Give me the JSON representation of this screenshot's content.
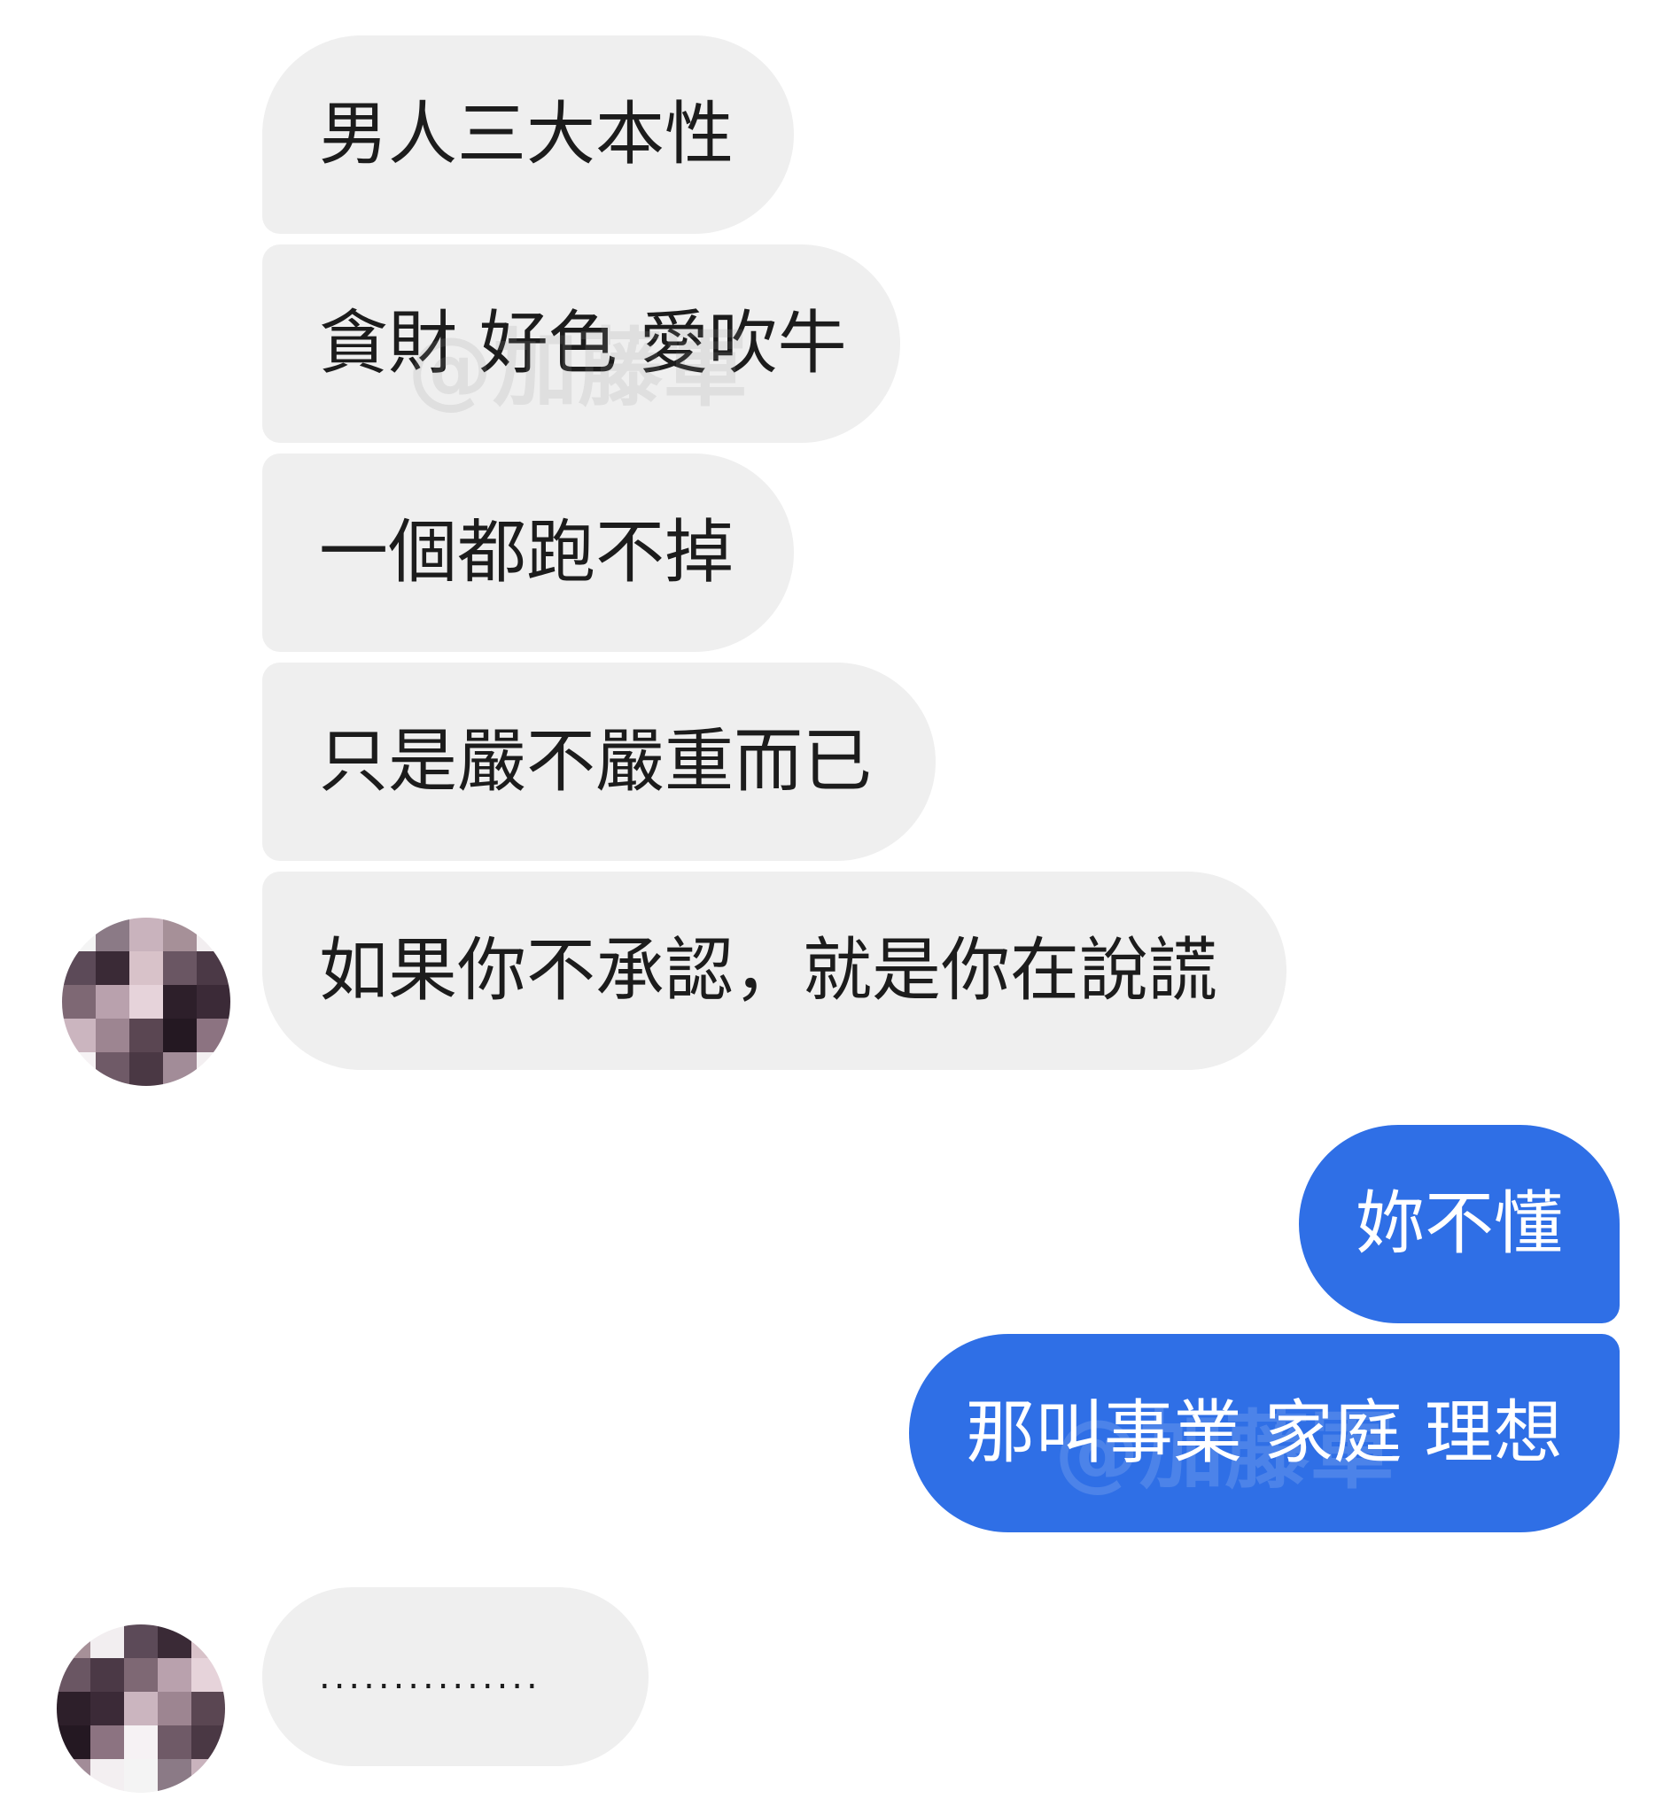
{
  "conversation": {
    "incoming_group_1": [
      {
        "text": "男人三大本性"
      },
      {
        "text": "貪財 好色 愛吹牛"
      },
      {
        "text": "一個都跑不掉"
      },
      {
        "text": "只是嚴不嚴重而已"
      },
      {
        "text": "如果你不承認，就是你在說謊"
      }
    ],
    "outgoing_group": [
      {
        "text": "妳不懂"
      },
      {
        "text": "那叫事業 家庭 理想"
      }
    ],
    "incoming_group_2": [
      {
        "text": "..............."
      }
    ]
  },
  "watermark": {
    "text": "@加藤軍"
  },
  "colors": {
    "incoming_bubble": "#efefef",
    "outgoing_bubble": "#2f6fe6",
    "incoming_text": "#1c1c1c",
    "outgoing_text": "#ffffff"
  },
  "avatar": {
    "icon": "pixelated-avatar-icon",
    "pixel_colors": [
      "#f4f4f4",
      "#8b7a86",
      "#c9b3bd",
      "#a69098",
      "#f2eef0",
      "#5c4a58",
      "#3a2a36",
      "#d8c2c9",
      "#6a5663",
      "#4b3946",
      "#7e6874",
      "#b9a1ad",
      "#e6d3da",
      "#2d1f2a",
      "#3b2a37",
      "#cbb5bf",
      "#9d8591",
      "#5a4652",
      "#241822",
      "#8c7381",
      "#f6f2f4",
      "#6f5a67",
      "#4a3844",
      "#a28c98",
      "#f3eff1"
    ]
  }
}
